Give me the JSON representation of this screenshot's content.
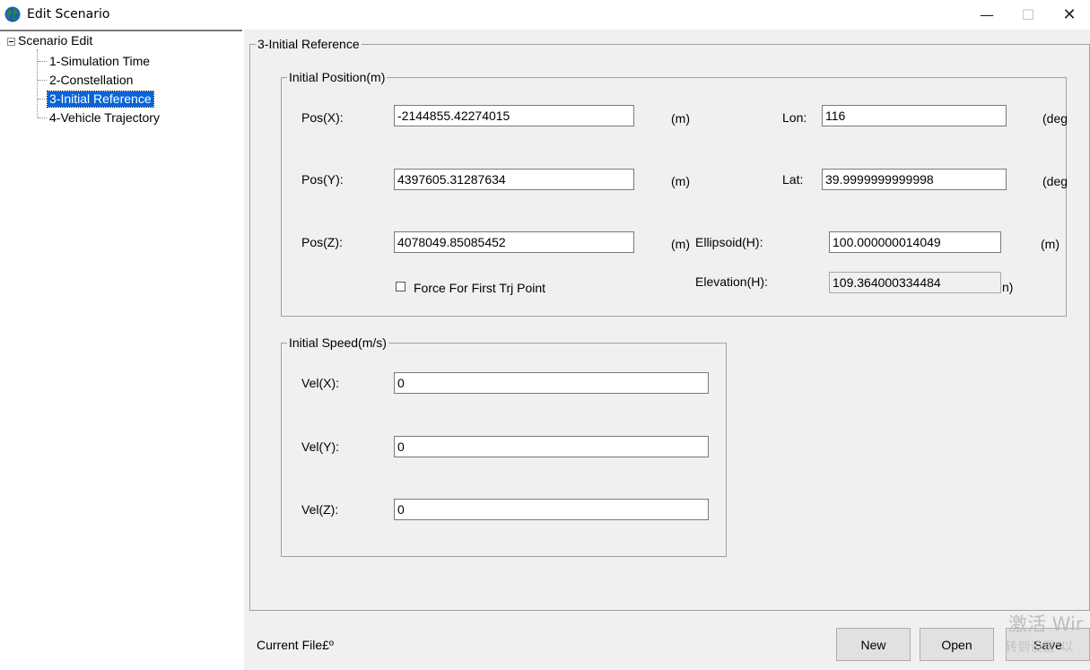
{
  "window": {
    "title": "Edit Scenario",
    "controls": {
      "minimize": "—",
      "maximize": "☐",
      "close": "✕"
    }
  },
  "tree": {
    "root": "Scenario Edit",
    "items": [
      "1-Simulation Time",
      "2-Constellation",
      "3-Initial Reference",
      "4-Vehicle Trajectory"
    ],
    "selected_index": 2
  },
  "main_group": {
    "label": "3-Initial Reference"
  },
  "position_group": {
    "label": "Initial Position(m)",
    "pos_x": {
      "label": "Pos(X):",
      "value": "-2144855.42274015",
      "unit": "(m)"
    },
    "pos_y": {
      "label": "Pos(Y):",
      "value": "4397605.31287634",
      "unit": "(m)"
    },
    "pos_z": {
      "label": "Pos(Z):",
      "value": "4078049.85085452",
      "unit": "(m)"
    },
    "lon": {
      "label": "Lon:",
      "value": "116",
      "unit": "(deg"
    },
    "lat": {
      "label": "Lat:",
      "value": "39.9999999999998",
      "unit": "(deg"
    },
    "ellipsoid": {
      "label": "Ellipsoid(H):",
      "value": "100.000000014049",
      "unit": "(m)"
    },
    "elevation": {
      "label": "Elevation(H):",
      "value": "109.364000334484",
      "unit": "n)"
    },
    "force_first_point": {
      "label": "Force For First Trj Point",
      "checked": false
    }
  },
  "speed_group": {
    "label": "Initial Speed(m/s)",
    "vel_x": {
      "label": "Vel(X):",
      "value": "0"
    },
    "vel_y": {
      "label": "Vel(Y):",
      "value": "0"
    },
    "vel_z": {
      "label": "Vel(Z):",
      "value": "0"
    }
  },
  "footer": {
    "current_file_label": "Current File£º",
    "buttons": {
      "new": "New",
      "open": "Open",
      "save": "Save"
    }
  },
  "watermark": {
    "line1": "激活 Wir",
    "line2": "转到设置\"以"
  },
  "colors": {
    "selection": "#0a64d8",
    "panel_bg": "#f0f0f0",
    "button_bg": "#e1e1e1"
  }
}
